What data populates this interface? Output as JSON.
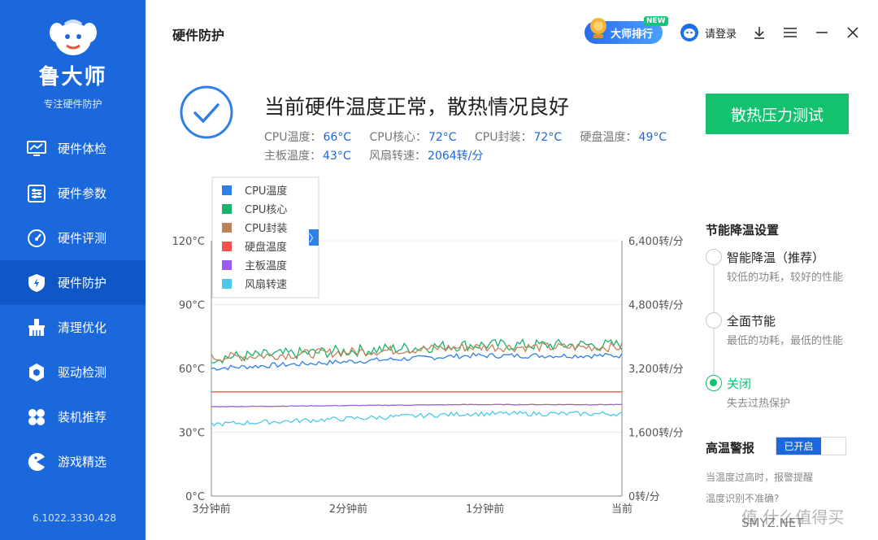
{
  "sidebar": {
    "app_name": "鲁大师",
    "subtitle": "专注硬件防护",
    "items": [
      {
        "label": "硬件体检",
        "icon": "monitor-icon"
      },
      {
        "label": "硬件参数",
        "icon": "sliders-icon"
      },
      {
        "label": "硬件评测",
        "icon": "gauge-icon"
      },
      {
        "label": "硬件防护",
        "icon": "shield-icon",
        "active": true
      },
      {
        "label": "清理优化",
        "icon": "broom-icon"
      },
      {
        "label": "驱动检测",
        "icon": "gear-icon"
      },
      {
        "label": "装机推荐",
        "icon": "grid-icon"
      },
      {
        "label": "游戏精选",
        "icon": "pacman-icon"
      }
    ],
    "version": "6.1022.3330.428"
  },
  "header": {
    "title": "硬件防护",
    "rank_label": "大师排行",
    "new_tag": "NEW",
    "login_label": "请登录"
  },
  "status": {
    "title": "当前硬件温度正常，散热情况良好",
    "readouts": [
      {
        "label": "CPU温度：",
        "value": "66°C"
      },
      {
        "label": "CPU核心：",
        "value": "72°C"
      },
      {
        "label": "CPU封装：",
        "value": "72°C"
      },
      {
        "label": "硬盘温度：",
        "value": "49°C"
      },
      {
        "label": "主板温度：",
        "value": "43°C"
      },
      {
        "label": "风扇转速：",
        "value": "2064转/分"
      }
    ],
    "stress_button": "散热压力测试"
  },
  "chart_data": {
    "type": "line",
    "x": [
      "3分钟前",
      "2分钟前",
      "1分钟前",
      "当前"
    ],
    "left_axis": {
      "ticks": [
        "0°C",
        "30°C",
        "60°C",
        "90°C",
        "120°C"
      ],
      "range": [
        0,
        120
      ]
    },
    "right_axis": {
      "ticks": [
        "0转/分",
        "1,600转/分",
        "3,200转/分",
        "4,800转/分",
        "6,400转/分"
      ],
      "range": [
        0,
        6400
      ]
    },
    "legend_expand": "〉",
    "series": [
      {
        "name": "CPU温度",
        "color": "#2f7fe6",
        "axis": "left",
        "start": 60,
        "end": 66,
        "noise": 1.2
      },
      {
        "name": "CPU核心",
        "color": "#19b36b",
        "axis": "left",
        "start": 65,
        "end": 71,
        "noise": 2.8
      },
      {
        "name": "CPU封装",
        "color": "#c0825a",
        "axis": "left",
        "start": 65,
        "end": 70,
        "noise": 2.2
      },
      {
        "name": "硬盘温度",
        "color": "#ef5350",
        "axis": "left",
        "start": 49,
        "end": 49,
        "noise": 0
      },
      {
        "name": "主板温度",
        "color": "#9c5cf0",
        "axis": "left",
        "start": 42,
        "end": 43,
        "noise": 0.15
      },
      {
        "name": "风扇转速",
        "color": "#4cc9e8",
        "axis": "right",
        "start": 1800,
        "end": 2064,
        "noise": 60
      }
    ]
  },
  "settings": {
    "title": "节能降温设置",
    "options": [
      {
        "label": "智能降温（推荐）",
        "desc": "较低的功耗，较好的性能",
        "selected": false
      },
      {
        "label": "全面节能",
        "desc": "最低的功耗，最低的性能",
        "selected": false
      },
      {
        "label": "关闭",
        "desc": "失去过热保护",
        "selected": true
      }
    ],
    "alarm_title": "高温警报",
    "alarm_toggle": "已开启",
    "alarm_desc": "当温度过高时，报警提醒",
    "alarm_link": "温度识别不准确?"
  },
  "watermark": {
    "text": "值 什么值得买",
    "sub": "SMYZ.NET"
  }
}
